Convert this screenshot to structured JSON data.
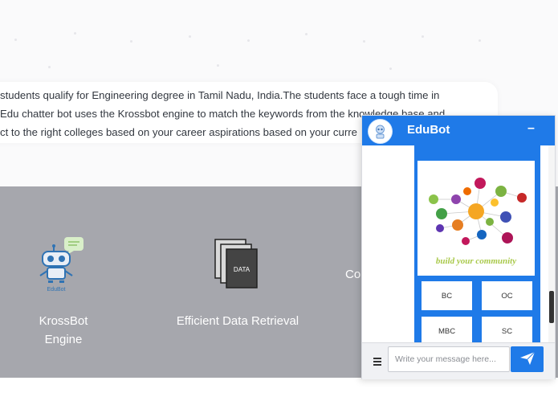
{
  "intro": {
    "lines": [
      "students qualify for Engineering degree in Tamil Nadu, India.The students face a tough time in",
      "Edu chatter bot uses the Krossbot engine to match the keywords from the knowledge base and",
      "ct to the right colleges based on your career aspirations based on your curre"
    ]
  },
  "features": {
    "items": [
      {
        "label_line1": "KrossBot",
        "label_line2": "Engine",
        "icon": "robot-icon",
        "icon_label": "EduBot"
      },
      {
        "label_line1": "Efficient Data Retrieval",
        "icon": "data-stack-icon",
        "icon_label": "DATA"
      },
      {
        "label_line1": "Co"
      }
    ]
  },
  "chat": {
    "title": "EduBot",
    "minimize": "–",
    "card": {
      "image_caption": "build your community",
      "buttons": [
        "BC",
        "OC",
        "MBC",
        "SC"
      ]
    },
    "input_placeholder": "Write your message here...",
    "colors": {
      "accent": "#1f7ae8",
      "features_bg": "#a6a7ad"
    }
  }
}
